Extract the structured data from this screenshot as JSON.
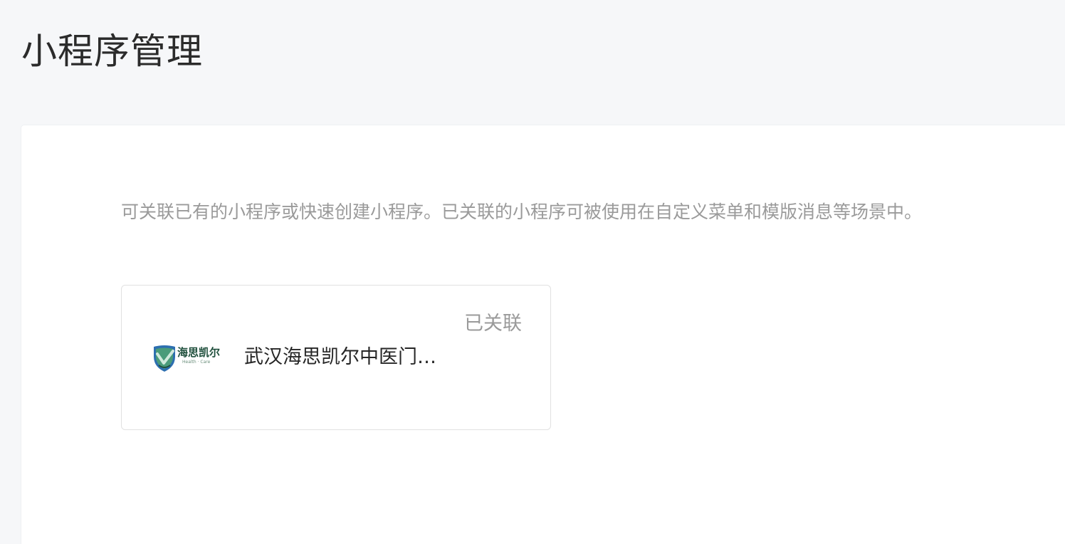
{
  "header": {
    "title": "小程序管理"
  },
  "main": {
    "description": "可关联已有的小程序或快速创建小程序。已关联的小程序可被使用在自定义菜单和模版消息等场景中。",
    "mini_programs": [
      {
        "name": "武汉海思凯尔中医门诊部",
        "status": "已关联",
        "logo": {
          "icon": "shield-logo-icon",
          "text": "海思凯尔",
          "subtext": "Health · Care"
        }
      }
    ]
  },
  "colors": {
    "page_background": "#f6f7f9",
    "panel_background": "#ffffff",
    "muted_text": "#9a9a9a",
    "primary_text": "#262626",
    "logo_green": "#1f4f3c",
    "logo_blue": "#2d6fb0"
  }
}
